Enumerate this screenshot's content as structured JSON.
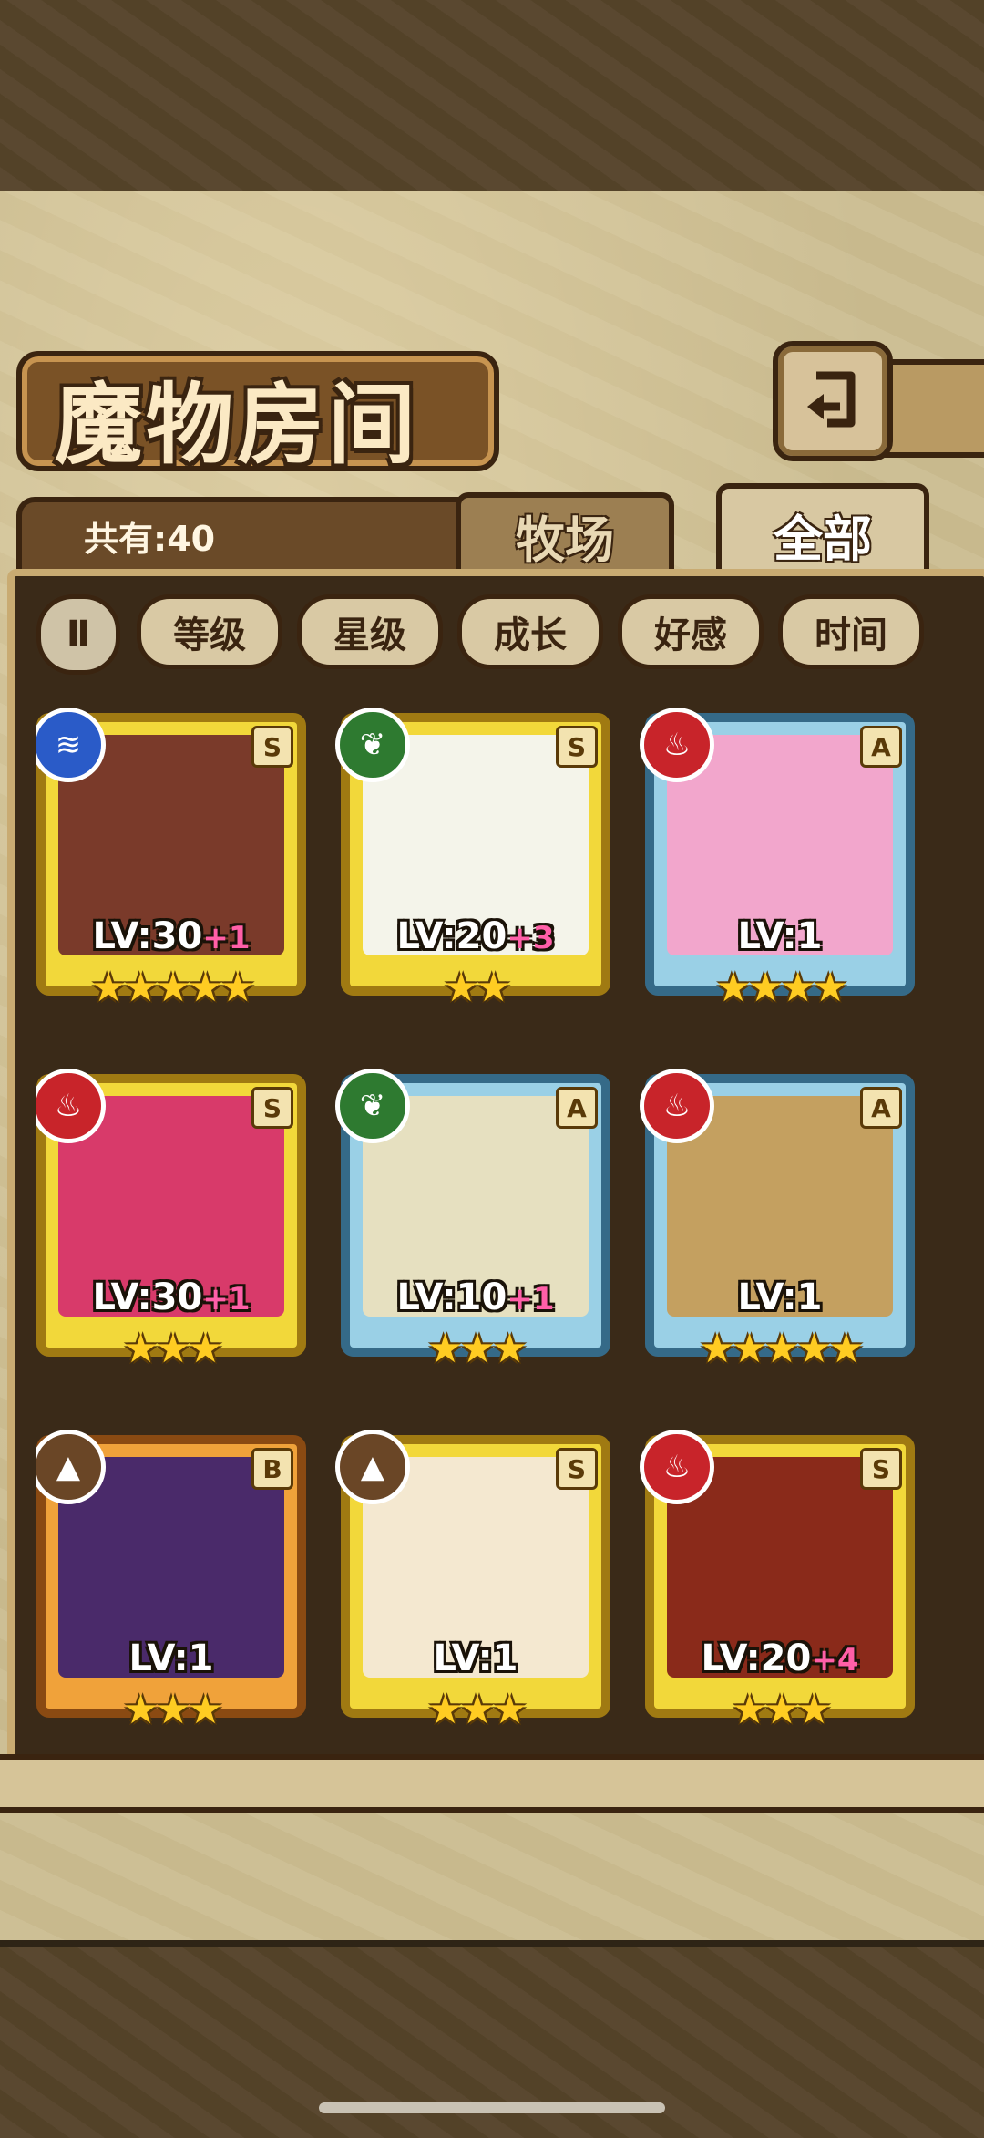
{
  "title": "魔物房间",
  "count_label": "共有:40",
  "tabs": [
    {
      "label": "牧场",
      "active": false
    },
    {
      "label": "全部",
      "active": true
    }
  ],
  "sort_toggle_label": "Ⅱ",
  "sort_buttons": [
    "等级",
    "星级",
    "成长",
    "好感",
    "时间"
  ],
  "monsters": [
    {
      "level": "LV:30",
      "plus": "+1",
      "stars": 5,
      "rank": "S",
      "element": "water-icon",
      "frame": "gold",
      "art_color": "#7a3a2a"
    },
    {
      "level": "LV:20",
      "plus": "+3",
      "stars": 2,
      "rank": "S",
      "element": "leaf-icon",
      "frame": "gold",
      "art_color": "#f4f4ea"
    },
    {
      "level": "LV:1",
      "plus": "",
      "stars": 4,
      "rank": "A",
      "element": "fire-icon",
      "frame": "blue",
      "art_color": "#f2a6cc"
    },
    {
      "level": "LV:30",
      "plus": "+1",
      "stars": 3,
      "rank": "S",
      "element": "fire-icon",
      "frame": "gold",
      "art_color": "#d83a6a"
    },
    {
      "level": "LV:10",
      "plus": "+1",
      "stars": 3,
      "rank": "A",
      "element": "leaf-icon",
      "frame": "blue",
      "art_color": "#e6e0c0"
    },
    {
      "level": "LV:1",
      "plus": "",
      "stars": 5,
      "rank": "A",
      "element": "fire-icon",
      "frame": "blue",
      "art_color": "#c4a060"
    },
    {
      "level": "LV:1",
      "plus": "",
      "stars": 3,
      "rank": "B",
      "element": "earth-icon",
      "frame": "orange",
      "art_color": "#4a2a6a"
    },
    {
      "level": "LV:1",
      "plus": "",
      "stars": 3,
      "rank": "S",
      "element": "earth-icon",
      "frame": "gold",
      "art_color": "#f4e8d0"
    },
    {
      "level": "LV:20",
      "plus": "+4",
      "stars": 3,
      "rank": "S",
      "element": "fire-icon",
      "frame": "gold",
      "art_color": "#8a2a1a"
    }
  ]
}
